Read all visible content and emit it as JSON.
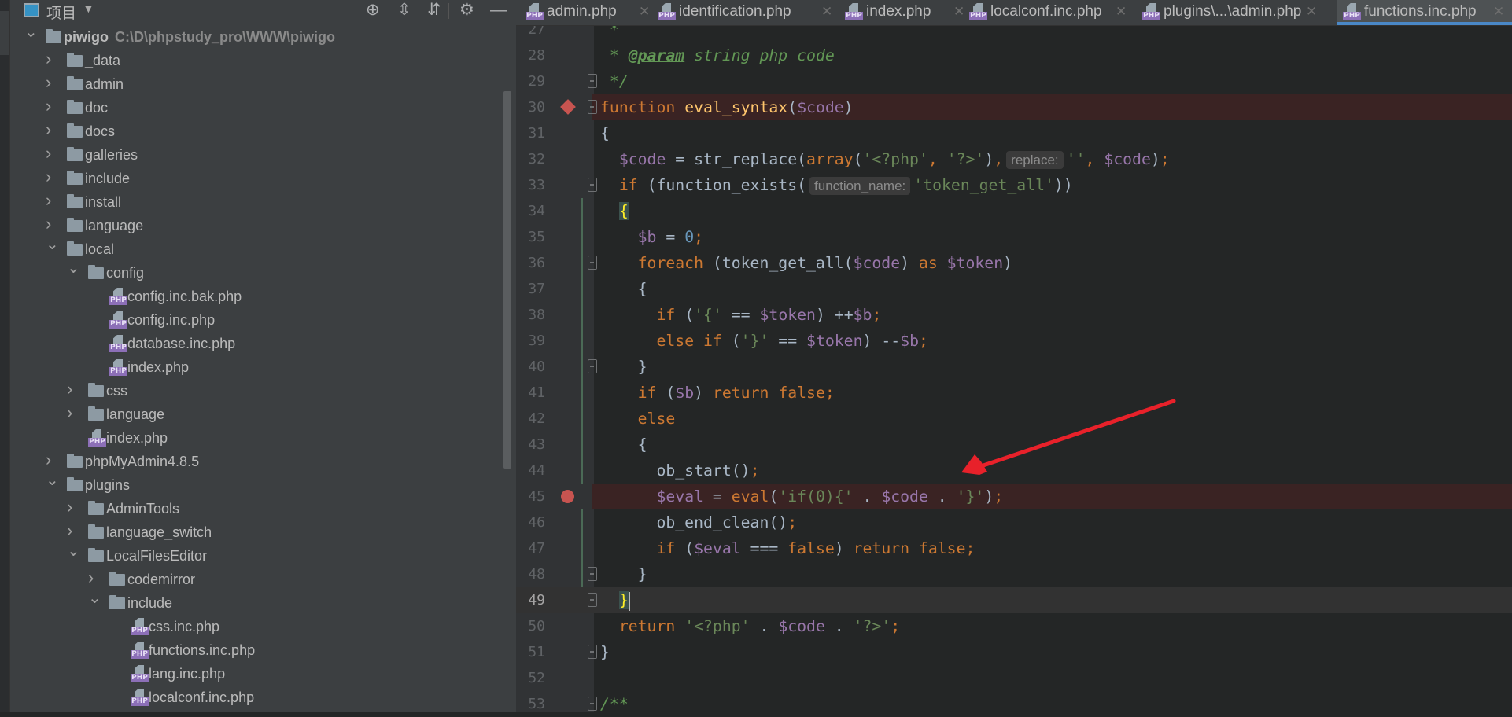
{
  "sidebar": {
    "title": "项目",
    "icons": [
      "locate-icon",
      "expand-all-icon",
      "collapse-all-icon",
      "gear-icon",
      "minimize-icon"
    ],
    "tree": [
      {
        "label": "piwigo",
        "path": "C:\\D\\phpstudy_pro\\WWW\\piwigo",
        "depth": 0,
        "type": "folder",
        "state": "open",
        "bold": true
      },
      {
        "label": "_data",
        "depth": 1,
        "type": "folder",
        "state": "closed"
      },
      {
        "label": "admin",
        "depth": 1,
        "type": "folder",
        "state": "closed"
      },
      {
        "label": "doc",
        "depth": 1,
        "type": "folder",
        "state": "closed"
      },
      {
        "label": "docs",
        "depth": 1,
        "type": "folder",
        "state": "closed"
      },
      {
        "label": "galleries",
        "depth": 1,
        "type": "folder",
        "state": "closed"
      },
      {
        "label": "include",
        "depth": 1,
        "type": "folder",
        "state": "closed"
      },
      {
        "label": "install",
        "depth": 1,
        "type": "folder",
        "state": "closed"
      },
      {
        "label": "language",
        "depth": 1,
        "type": "folder",
        "state": "closed"
      },
      {
        "label": "local",
        "depth": 1,
        "type": "folder",
        "state": "open"
      },
      {
        "label": "config",
        "depth": 2,
        "type": "folder",
        "state": "open"
      },
      {
        "label": "config.inc.bak.php",
        "depth": 3,
        "type": "php"
      },
      {
        "label": "config.inc.php",
        "depth": 3,
        "type": "php"
      },
      {
        "label": "database.inc.php",
        "depth": 3,
        "type": "php"
      },
      {
        "label": "index.php",
        "depth": 3,
        "type": "php"
      },
      {
        "label": "css",
        "depth": 2,
        "type": "folder",
        "state": "closed"
      },
      {
        "label": "language",
        "depth": 2,
        "type": "folder",
        "state": "closed"
      },
      {
        "label": "index.php",
        "depth": 2,
        "type": "php"
      },
      {
        "label": "phpMyAdmin4.8.5",
        "depth": 1,
        "type": "folder",
        "state": "closed"
      },
      {
        "label": "plugins",
        "depth": 1,
        "type": "folder",
        "state": "open"
      },
      {
        "label": "AdminTools",
        "depth": 2,
        "type": "folder",
        "state": "closed"
      },
      {
        "label": "language_switch",
        "depth": 2,
        "type": "folder",
        "state": "closed"
      },
      {
        "label": "LocalFilesEditor",
        "depth": 2,
        "type": "folder",
        "state": "open"
      },
      {
        "label": "codemirror",
        "depth": 3,
        "type": "folder",
        "state": "closed"
      },
      {
        "label": "include",
        "depth": 3,
        "type": "folder",
        "state": "open"
      },
      {
        "label": "css.inc.php",
        "depth": 4,
        "type": "php"
      },
      {
        "label": "functions.inc.php",
        "depth": 4,
        "type": "php"
      },
      {
        "label": "lang.inc.php",
        "depth": 4,
        "type": "php"
      },
      {
        "label": "localconf.inc.php",
        "depth": 4,
        "type": "php"
      }
    ]
  },
  "tabs": [
    {
      "label": "admin.php",
      "active": false
    },
    {
      "label": "identification.php",
      "active": false
    },
    {
      "label": "index.php",
      "active": false
    },
    {
      "label": "localconf.inc.php",
      "active": false
    },
    {
      "label": "plugins\\...\\admin.php",
      "active": false
    },
    {
      "label": "functions.inc.php",
      "active": true
    }
  ],
  "php_badge": "PHP",
  "colors": {
    "accent": "#4a88c7",
    "breakpoint": "#c75450",
    "annotation_arrow": "#e8212a"
  },
  "editor": {
    "lines": [
      {
        "n": 27,
        "fold": false,
        "t": [
          [
            "c",
            " *"
          ]
        ]
      },
      {
        "n": 28,
        "t": [
          [
            "c",
            " * "
          ],
          [
            "d",
            "@param"
          ],
          [
            "c",
            " string php code"
          ]
        ]
      },
      {
        "n": 29,
        "fold": true,
        "t": [
          [
            "c",
            " */"
          ]
        ]
      },
      {
        "n": 30,
        "fold": true,
        "bp": "method",
        "t": [
          [
            "k",
            "function "
          ],
          [
            "f",
            "eval_syntax"
          ],
          [
            "t",
            "("
          ],
          [
            "v",
            "$code"
          ],
          [
            "t",
            ")"
          ]
        ]
      },
      {
        "n": 31,
        "t": [
          [
            "t",
            "{"
          ]
        ]
      },
      {
        "n": 32,
        "t": [
          [
            "t",
            "  "
          ],
          [
            "v",
            "$code"
          ],
          [
            "t",
            " = str_replace("
          ],
          [
            "k",
            "array"
          ],
          [
            "t",
            "("
          ],
          [
            "s",
            "'<?php'"
          ],
          [
            "p",
            ", "
          ],
          [
            "s",
            "'?>'"
          ],
          [
            "t",
            ")"
          ],
          [
            "p",
            ","
          ],
          [
            "h",
            "replace:"
          ],
          [
            "s",
            "''"
          ],
          [
            "p",
            ", "
          ],
          [
            "v",
            "$code"
          ],
          [
            "t",
            ")"
          ],
          [
            "p",
            ";"
          ]
        ]
      },
      {
        "n": 33,
        "fold": true,
        "t": [
          [
            "t",
            "  "
          ],
          [
            "k",
            "if "
          ],
          [
            "t",
            "(function_exists("
          ],
          [
            "h",
            "function_name:"
          ],
          [
            "s",
            "'token_get_all'"
          ],
          [
            "t",
            "))"
          ]
        ]
      },
      {
        "n": 34,
        "t": [
          [
            "t",
            "  "
          ],
          [
            "y",
            "{"
          ]
        ]
      },
      {
        "n": 35,
        "t": [
          [
            "t",
            "    "
          ],
          [
            "v",
            "$b"
          ],
          [
            "t",
            " = "
          ],
          [
            "n",
            "0"
          ],
          [
            "p",
            ";"
          ]
        ]
      },
      {
        "n": 36,
        "fold": true,
        "t": [
          [
            "t",
            "    "
          ],
          [
            "k",
            "foreach "
          ],
          [
            "t",
            "(token_get_all("
          ],
          [
            "v",
            "$code"
          ],
          [
            "t",
            ") "
          ],
          [
            "k",
            "as "
          ],
          [
            "v",
            "$token"
          ],
          [
            "t",
            ")"
          ]
        ]
      },
      {
        "n": 37,
        "t": [
          [
            "t",
            "    {"
          ]
        ]
      },
      {
        "n": 38,
        "t": [
          [
            "t",
            "      "
          ],
          [
            "k",
            "if "
          ],
          [
            "t",
            "("
          ],
          [
            "s",
            "'{'"
          ],
          [
            "t",
            " == "
          ],
          [
            "v",
            "$token"
          ],
          [
            "t",
            ") ++"
          ],
          [
            "v",
            "$b"
          ],
          [
            "p",
            ";"
          ]
        ]
      },
      {
        "n": 39,
        "t": [
          [
            "t",
            "      "
          ],
          [
            "k",
            "else if "
          ],
          [
            "t",
            "("
          ],
          [
            "s",
            "'}'"
          ],
          [
            "t",
            " == "
          ],
          [
            "v",
            "$token"
          ],
          [
            "t",
            ") --"
          ],
          [
            "v",
            "$b"
          ],
          [
            "p",
            ";"
          ]
        ]
      },
      {
        "n": 40,
        "fold": true,
        "t": [
          [
            "t",
            "    }"
          ]
        ]
      },
      {
        "n": 41,
        "t": [
          [
            "t",
            "    "
          ],
          [
            "k",
            "if "
          ],
          [
            "t",
            "("
          ],
          [
            "v",
            "$b"
          ],
          [
            "t",
            ") "
          ],
          [
            "k",
            "return false"
          ],
          [
            "p",
            ";"
          ]
        ]
      },
      {
        "n": 42,
        "t": [
          [
            "t",
            "    "
          ],
          [
            "k",
            "else"
          ]
        ]
      },
      {
        "n": 43,
        "t": [
          [
            "t",
            "    {"
          ]
        ]
      },
      {
        "n": 44,
        "t": [
          [
            "t",
            "      ob_start()"
          ],
          [
            "p",
            ";"
          ]
        ]
      },
      {
        "n": 45,
        "bp": "line",
        "t": [
          [
            "t",
            "      "
          ],
          [
            "v",
            "$eval"
          ],
          [
            "t",
            " = "
          ],
          [
            "k",
            "eval"
          ],
          [
            "t",
            "("
          ],
          [
            "s",
            "'if(0){'"
          ],
          [
            "t",
            " . "
          ],
          [
            "v",
            "$code"
          ],
          [
            "t",
            " . "
          ],
          [
            "s",
            "'}'"
          ],
          [
            "t",
            ")"
          ],
          [
            "p",
            ";"
          ]
        ]
      },
      {
        "n": 46,
        "t": [
          [
            "t",
            "      ob_end_clean()"
          ],
          [
            "p",
            ";"
          ]
        ]
      },
      {
        "n": 47,
        "t": [
          [
            "t",
            "      "
          ],
          [
            "k",
            "if "
          ],
          [
            "t",
            "("
          ],
          [
            "v",
            "$eval"
          ],
          [
            "t",
            " === "
          ],
          [
            "k",
            "false"
          ],
          [
            "t",
            ") "
          ],
          [
            "k",
            "return false"
          ],
          [
            "p",
            ";"
          ]
        ]
      },
      {
        "n": 48,
        "fold": true,
        "t": [
          [
            "t",
            "    }"
          ]
        ]
      },
      {
        "n": 49,
        "fold": true,
        "current": true,
        "t": [
          [
            "t",
            "  "
          ],
          [
            "y",
            "}"
          ],
          [
            "caret",
            ""
          ]
        ]
      },
      {
        "n": 50,
        "t": [
          [
            "t",
            "  "
          ],
          [
            "k",
            "return "
          ],
          [
            "s",
            "'<?php'"
          ],
          [
            "t",
            " . "
          ],
          [
            "v",
            "$code"
          ],
          [
            "t",
            " . "
          ],
          [
            "s",
            "'?>'"
          ],
          [
            "p",
            ";"
          ]
        ]
      },
      {
        "n": 51,
        "fold": true,
        "t": [
          [
            "t",
            "}"
          ]
        ]
      },
      {
        "n": 52,
        "t": []
      },
      {
        "n": 53,
        "fold": true,
        "t": [
          [
            "c",
            "/**"
          ]
        ]
      }
    ]
  }
}
